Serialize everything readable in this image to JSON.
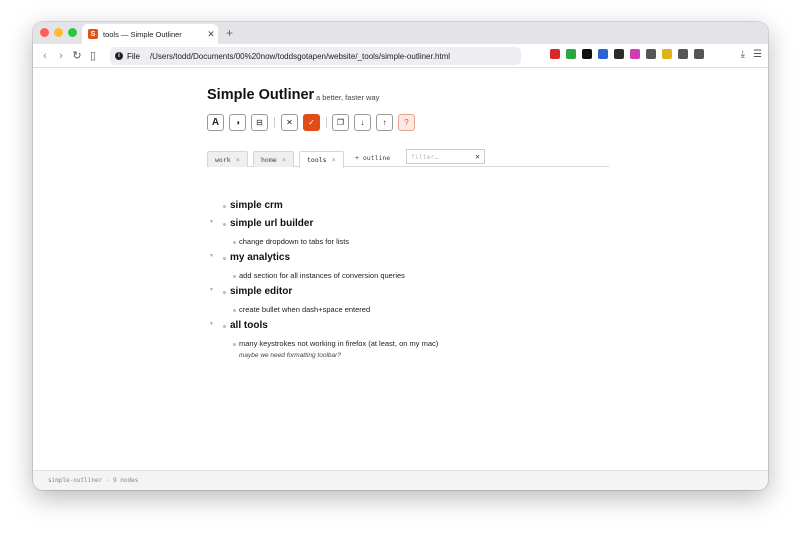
{
  "browser": {
    "tab_title": "tools — Simple Outliner",
    "tab_favicon": "S",
    "new_tab": "+",
    "url_scheme": "File",
    "url": "/Users/todd/Documents/00%20now/toddsgotapen/website/_tools/simple-outliner.html",
    "extension_colors": [
      "#d9262a",
      "#27a845",
      "#111111",
      "#2a63d4",
      "#2b2b2b",
      "#d03bb7",
      "#555555",
      "#e3b11a",
      "#555555",
      "#555555"
    ]
  },
  "app": {
    "title": "Simple Outliner",
    "subtitle": "a better, faster way",
    "toolbar": {
      "font": "A",
      "contrast": "◑",
      "collapse": "⊟",
      "clear": "✕",
      "check": "✓",
      "copy": "❐",
      "move_down": "↓",
      "move_up": "↑",
      "help": "?"
    },
    "tabs": [
      {
        "label": "work",
        "close": "×"
      },
      {
        "label": "home",
        "close": "×"
      },
      {
        "label": "tools",
        "close": "×"
      }
    ],
    "add_outline": "+ outline",
    "filter_placeholder": "filter…",
    "filter_clear": "✕"
  },
  "outline": [
    {
      "text": "simple crm"
    },
    {
      "text": "simple url builder",
      "children": [
        "change dropdown to tabs for lists"
      ]
    },
    {
      "text": "my analytics",
      "children": [
        "add section for all instances of conversion queries"
      ]
    },
    {
      "text": "simple editor",
      "children": [
        "create bullet when dash+space entered"
      ]
    },
    {
      "text": "all tools",
      "children": [
        "many keystrokes not working in firefox (at least, on my mac)"
      ],
      "note": "maybe we need formatting toolbar?"
    }
  ],
  "status": "simple-outliner · 9 nodes"
}
